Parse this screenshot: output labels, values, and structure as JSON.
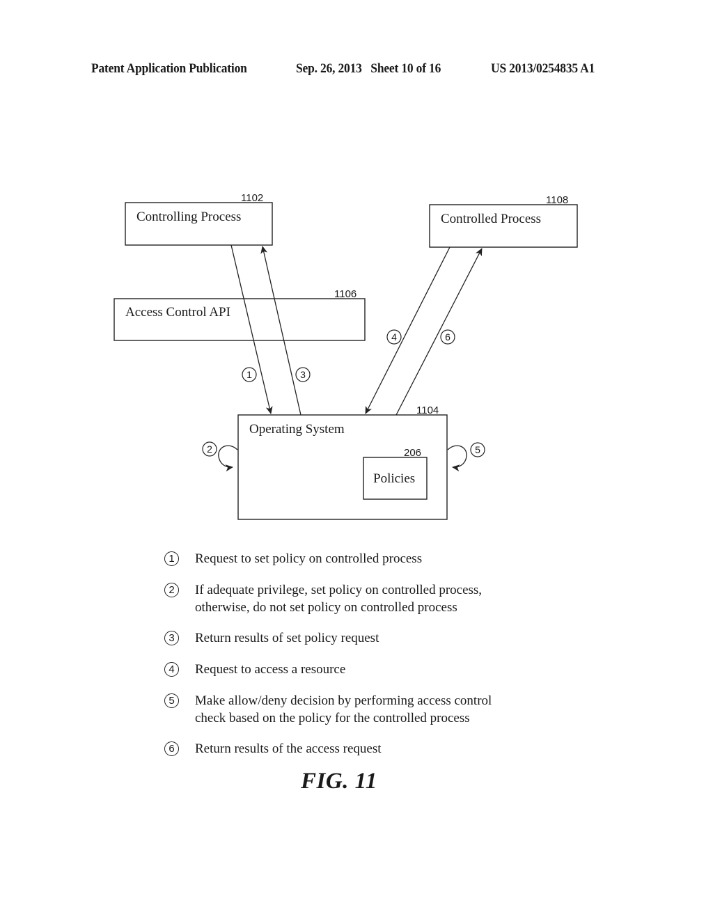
{
  "header": {
    "publication_type": "Patent Application Publication",
    "date_sheet": "Sep. 26, 2013   Sheet 10 of 16",
    "publication_number": "US 2013/0254835 A1"
  },
  "diagram": {
    "boxes": {
      "controlling_process": {
        "label": "Controlling Process",
        "ref": "1102"
      },
      "controlled_process": {
        "label": "Controlled Process",
        "ref": "1108"
      },
      "access_control_api": {
        "label": "Access Control API",
        "ref": "1106"
      },
      "operating_system": {
        "label": "Operating System",
        "ref": "1104"
      },
      "policies": {
        "label": "Policies",
        "ref": "206"
      }
    },
    "step_markers": [
      "1",
      "2",
      "3",
      "4",
      "5",
      "6"
    ]
  },
  "legend": [
    {
      "num": "1",
      "text": "Request to set policy on controlled process"
    },
    {
      "num": "2",
      "text": "If adequate privilege, set policy on controlled process,\notherwise, do not set policy on controlled process"
    },
    {
      "num": "3",
      "text": "Return results of set policy request"
    },
    {
      "num": "4",
      "text": "Request to access a resource"
    },
    {
      "num": "5",
      "text": "Make allow/deny decision by performing access control\ncheck based on the policy for the controlled process"
    },
    {
      "num": "6",
      "text": "Return results of the access request"
    }
  ],
  "figure_label": "FIG. 11"
}
